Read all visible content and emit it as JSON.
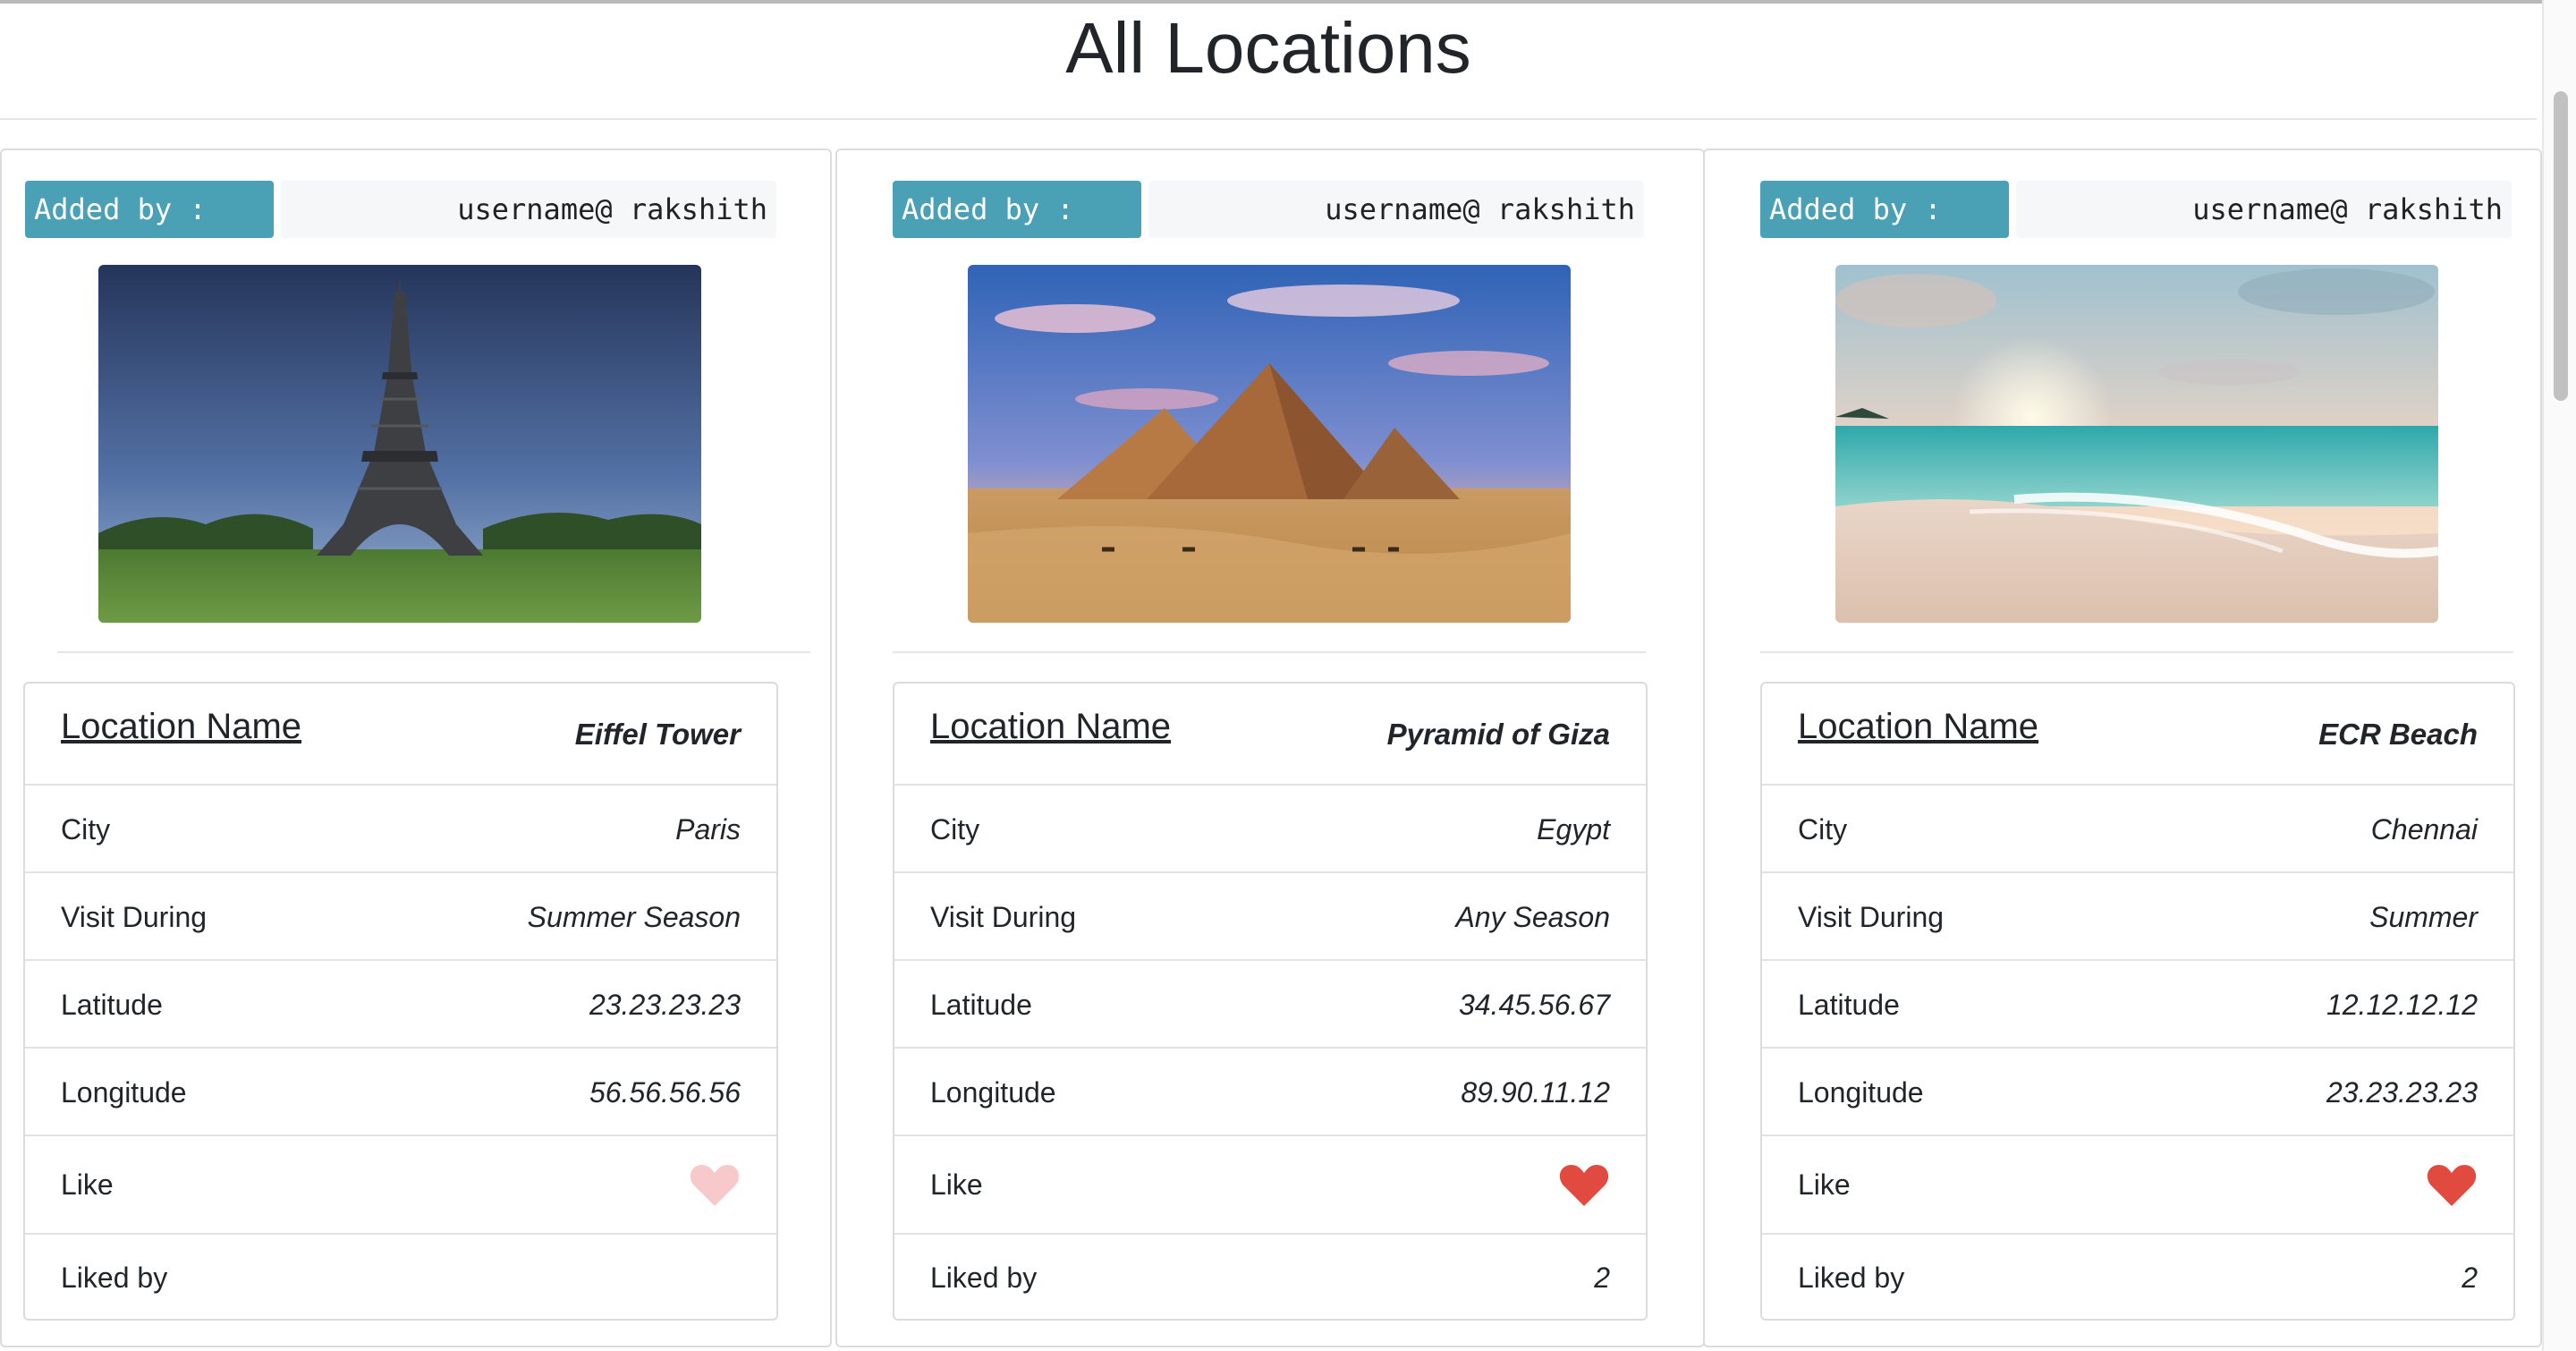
{
  "page": {
    "title": "All Locations"
  },
  "labels": {
    "added_by": "Added by :",
    "location_name": "Location Name",
    "city": "City",
    "visit_during": "Visit During",
    "latitude": "Latitude",
    "longitude": "Longitude",
    "like": "Like",
    "liked_by": "Liked by"
  },
  "colors": {
    "added_by_bg": "#4aa0b5",
    "heart_liked": "#e04a3f",
    "heart_unliked": "#f7c9cb"
  },
  "locations": [
    {
      "added_by": "username@ rakshith",
      "image": "eiffel-tower-photo",
      "name": "Eiffel Tower",
      "city": "Paris",
      "visit_during": "Summer Season",
      "latitude": "23.23.23.23",
      "longitude": "56.56.56.56",
      "liked": false,
      "liked_by": ""
    },
    {
      "added_by": "username@ rakshith",
      "image": "pyramids-photo",
      "name": "Pyramid of Giza",
      "city": "Egypt",
      "visit_during": "Any Season",
      "latitude": "34.45.56.67",
      "longitude": "89.90.11.12",
      "liked": true,
      "liked_by": "2"
    },
    {
      "added_by": "username@ rakshith",
      "image": "beach-photo",
      "name": "ECR Beach",
      "city": "Chennai",
      "visit_during": "Summer",
      "latitude": "12.12.12.12",
      "longitude": "23.23.23.23",
      "liked": true,
      "liked_by": "2"
    }
  ]
}
